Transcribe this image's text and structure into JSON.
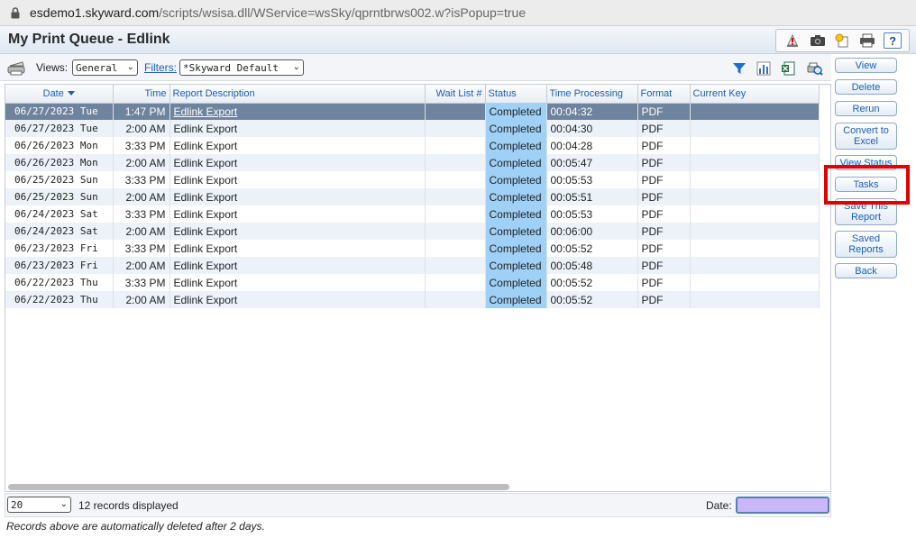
{
  "url": {
    "host": "esdemo1.skyward.com",
    "path": "/scripts/wsisa.dll/WService=wsSky/qprntbrws002.w?isPopup=true"
  },
  "page_title": "My Print Queue - Edlink",
  "toolbar": {
    "views_label": "Views:",
    "views_value": "General",
    "filters_label": "Filters:",
    "filters_value": "*Skyward Default"
  },
  "table": {
    "columns": [
      "Date",
      "Time",
      "Report Description",
      "Wait List #",
      "Status",
      "Time Processing",
      "Format",
      "Current Key"
    ],
    "rows": [
      [
        "06/27/2023 Tue",
        "1:47 PM",
        "Edlink Export",
        "",
        "Completed",
        "00:04:32",
        "PDF",
        ""
      ],
      [
        "06/27/2023 Tue",
        "2:00 AM",
        "Edlink Export",
        "",
        "Completed",
        "00:04:30",
        "PDF",
        ""
      ],
      [
        "06/26/2023 Mon",
        "3:33 PM",
        "Edlink Export",
        "",
        "Completed",
        "00:04:28",
        "PDF",
        ""
      ],
      [
        "06/26/2023 Mon",
        "2:00 AM",
        "Edlink Export",
        "",
        "Completed",
        "00:05:47",
        "PDF",
        ""
      ],
      [
        "06/25/2023 Sun",
        "3:33 PM",
        "Edlink Export",
        "",
        "Completed",
        "00:05:53",
        "PDF",
        ""
      ],
      [
        "06/25/2023 Sun",
        "2:00 AM",
        "Edlink Export",
        "",
        "Completed",
        "00:05:51",
        "PDF",
        ""
      ],
      [
        "06/24/2023 Sat",
        "3:33 PM",
        "Edlink Export",
        "",
        "Completed",
        "00:05:53",
        "PDF",
        ""
      ],
      [
        "06/24/2023 Sat",
        "2:00 AM",
        "Edlink Export",
        "",
        "Completed",
        "00:06:00",
        "PDF",
        ""
      ],
      [
        "06/23/2023 Fri",
        "3:33 PM",
        "Edlink Export",
        "",
        "Completed",
        "00:05:52",
        "PDF",
        ""
      ],
      [
        "06/23/2023 Fri",
        "2:00 AM",
        "Edlink Export",
        "",
        "Completed",
        "00:05:48",
        "PDF",
        ""
      ],
      [
        "06/22/2023 Thu",
        "3:33 PM",
        "Edlink Export",
        "",
        "Completed",
        "00:05:52",
        "PDF",
        ""
      ],
      [
        "06/22/2023 Thu",
        "2:00 AM",
        "Edlink Export",
        "",
        "Completed",
        "00:05:52",
        "PDF",
        ""
      ]
    ],
    "selected_row": 0
  },
  "footer": {
    "page_size": "20",
    "records_text": "12 records displayed",
    "date_label": "Date:",
    "note": "Records above are automatically deleted after 2 days."
  },
  "sidebar": {
    "buttons": [
      "View",
      "Delete",
      "Rerun",
      "Convert to Excel",
      "View Status",
      "Tasks",
      "Save This Report",
      "Saved Reports",
      "Back"
    ]
  },
  "colors": {
    "status_cell": "#9fd0f5",
    "selected_row": "#6e839d",
    "highlight_box": "#e00000",
    "date_field": "#c9b7f7"
  }
}
